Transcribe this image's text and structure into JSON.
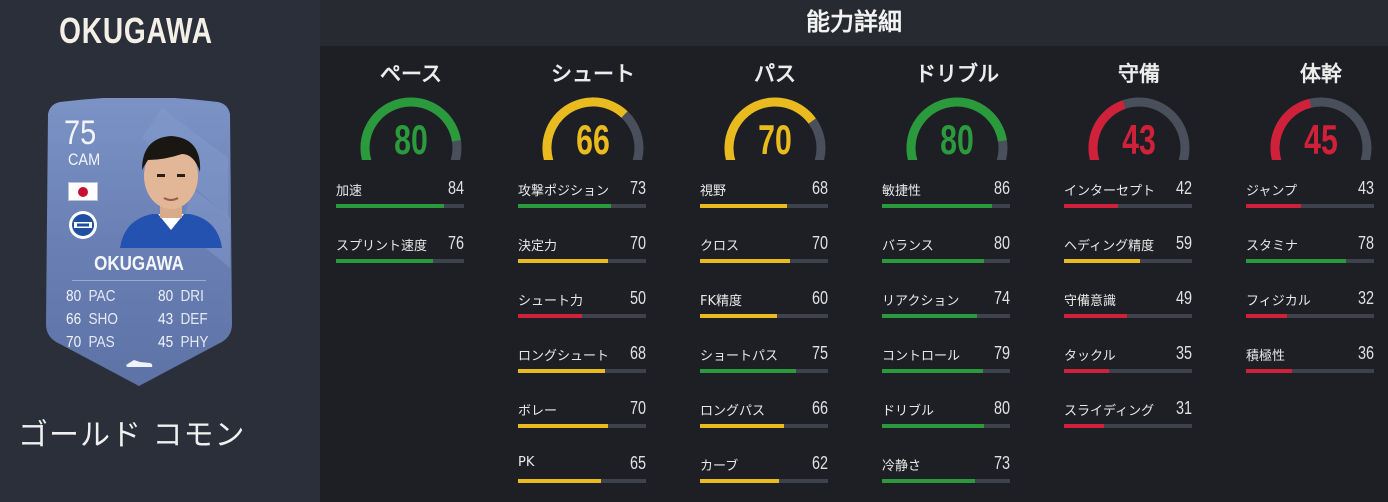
{
  "player": {
    "name": "OKUGAWA",
    "rarity": "ゴールド コモン",
    "card": {
      "rating": "75",
      "position": "CAM",
      "name": "OKUGAWA",
      "stats": [
        {
          "value": "80",
          "key": "PAC"
        },
        {
          "value": "80",
          "key": "DRI"
        },
        {
          "value": "66",
          "key": "SHO"
        },
        {
          "value": "43",
          "key": "DEF"
        },
        {
          "value": "70",
          "key": "PAS"
        },
        {
          "value": "45",
          "key": "PHY"
        }
      ]
    }
  },
  "section_title": "能力詳細",
  "colors": {
    "green": "#2a9a3c",
    "yellow": "#eabb1e",
    "red": "#d0213a",
    "gauge_track": "#49505c"
  },
  "categories": [
    {
      "title": "ペース",
      "value": "80",
      "level": "green",
      "attributes": [
        {
          "label": "加速",
          "value": "84"
        },
        {
          "label": "スプリント速度",
          "value": "76"
        }
      ]
    },
    {
      "title": "シュート",
      "value": "66",
      "level": "yellow",
      "attributes": [
        {
          "label": "攻撃ポジション",
          "value": "73"
        },
        {
          "label": "決定力",
          "value": "70"
        },
        {
          "label": "シュート力",
          "value": "50"
        },
        {
          "label": "ロングシュート",
          "value": "68"
        },
        {
          "label": "ボレー",
          "value": "70"
        },
        {
          "label": "PK",
          "value": "65"
        }
      ]
    },
    {
      "title": "パス",
      "value": "70",
      "level": "yellow",
      "attributes": [
        {
          "label": "視野",
          "value": "68"
        },
        {
          "label": "クロス",
          "value": "70"
        },
        {
          "label": "FK精度",
          "value": "60"
        },
        {
          "label": "ショートパス",
          "value": "75"
        },
        {
          "label": "ロングパス",
          "value": "66"
        },
        {
          "label": "カーブ",
          "value": "62"
        }
      ]
    },
    {
      "title": "ドリブル",
      "value": "80",
      "level": "green",
      "attributes": [
        {
          "label": "敏捷性",
          "value": "86"
        },
        {
          "label": "バランス",
          "value": "80"
        },
        {
          "label": "リアクション",
          "value": "74"
        },
        {
          "label": "コントロール",
          "value": "79"
        },
        {
          "label": "ドリブル",
          "value": "80"
        },
        {
          "label": "冷静さ",
          "value": "73"
        }
      ]
    },
    {
      "title": "守備",
      "value": "43",
      "level": "red",
      "attributes": [
        {
          "label": "インターセプト",
          "value": "42"
        },
        {
          "label": "ヘディング精度",
          "value": "59"
        },
        {
          "label": "守備意識",
          "value": "49"
        },
        {
          "label": "タックル",
          "value": "35"
        },
        {
          "label": "スライディング",
          "value": "31"
        }
      ]
    },
    {
      "title": "体幹",
      "value": "45",
      "level": "red",
      "attributes": [
        {
          "label": "ジャンプ",
          "value": "43"
        },
        {
          "label": "スタミナ",
          "value": "78"
        },
        {
          "label": "フィジカル",
          "value": "32"
        },
        {
          "label": "積極性",
          "value": "36"
        }
      ]
    }
  ]
}
